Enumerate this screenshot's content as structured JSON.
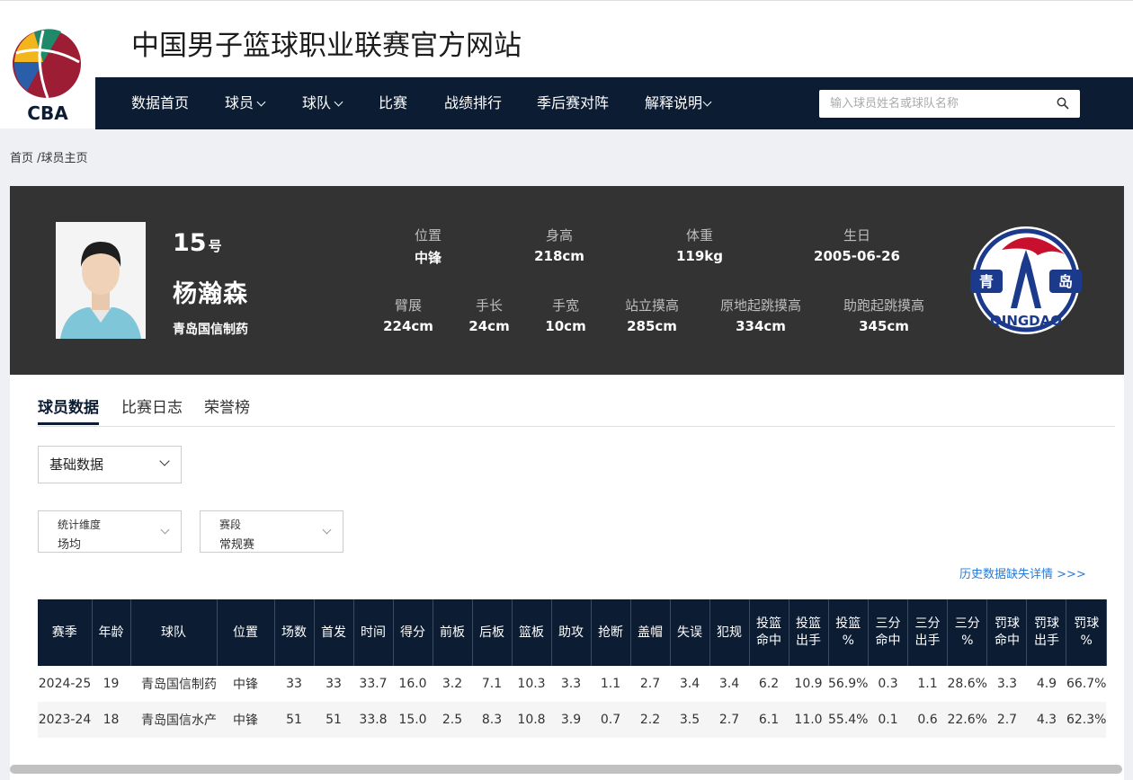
{
  "header": {
    "site_title": "中国男子篮球职业联赛官方网站",
    "logo_text": "CBA",
    "nav": [
      {
        "label": "数据首页",
        "has_dropdown": false
      },
      {
        "label": "球员",
        "has_dropdown": true
      },
      {
        "label": "球队",
        "has_dropdown": true
      },
      {
        "label": "比赛",
        "has_dropdown": false
      },
      {
        "label": "战绩排行",
        "has_dropdown": false
      },
      {
        "label": "季后赛对阵",
        "has_dropdown": false
      },
      {
        "label": "解释说明",
        "has_dropdown": true
      }
    ],
    "search_placeholder": "输入球员姓名或球队名称"
  },
  "breadcrumb": "首页 /球员主页",
  "player": {
    "number": "15",
    "number_suffix": "号",
    "name": "杨瀚森",
    "team": "青岛国信制药",
    "team_logo_text": "QINGDAO",
    "team_logo_chars": [
      "青",
      "岛"
    ],
    "stats_row1": [
      {
        "label": "位置",
        "value": "中锋"
      },
      {
        "label": "身高",
        "value": "218cm"
      },
      {
        "label": "体重",
        "value": "119kg"
      },
      {
        "label": "生日",
        "value": "2005-06-26"
      }
    ],
    "stats_row2": [
      {
        "label": "臂展",
        "value": "224cm"
      },
      {
        "label": "手长",
        "value": "24cm"
      },
      {
        "label": "手宽",
        "value": "10cm"
      },
      {
        "label": "站立摸高",
        "value": "285cm"
      },
      {
        "label": "原地起跳摸高",
        "value": "334cm"
      },
      {
        "label": "助跑起跳摸高",
        "value": "345cm"
      }
    ]
  },
  "tabs": [
    "球员数据",
    "比赛日志",
    "荣誉榜"
  ],
  "filters": {
    "main_select": "基础数据",
    "dimension": {
      "caption": "统计维度",
      "value": "场均"
    },
    "stage": {
      "caption": "赛段",
      "value": "常规赛"
    }
  },
  "history_link": "历史数据缺失详情 >>>",
  "table": {
    "headers": [
      "赛季",
      "年龄",
      "球队",
      "位置",
      "场数",
      "首发",
      "时间",
      "得分",
      "前板",
      "后板",
      "篮板",
      "助攻",
      "抢断",
      "盖帽",
      "失误",
      "犯规",
      "投篮\n命中",
      "投篮\n出手",
      "投篮\n%",
      "三分\n命中",
      "三分\n出手",
      "三分\n%",
      "罚球\n命中",
      "罚球\n出手",
      "罚球\n%"
    ],
    "rows": [
      [
        "2024-25",
        "19",
        "青岛国信制药",
        "中锋",
        "33",
        "33",
        "33.7",
        "16.0",
        "3.2",
        "7.1",
        "10.3",
        "3.3",
        "1.1",
        "2.7",
        "3.4",
        "3.4",
        "6.2",
        "10.9",
        "56.9%",
        "0.3",
        "1.1",
        "28.6%",
        "3.3",
        "4.9",
        "66.7%"
      ],
      [
        "2023-24",
        "18",
        "青岛国信水产",
        "中锋",
        "51",
        "51",
        "33.8",
        "15.0",
        "2.5",
        "8.3",
        "10.8",
        "3.9",
        "0.7",
        "2.2",
        "3.5",
        "2.7",
        "6.1",
        "11.0",
        "55.4%",
        "0.1",
        "0.6",
        "22.6%",
        "2.7",
        "4.3",
        "62.3%"
      ]
    ]
  }
}
